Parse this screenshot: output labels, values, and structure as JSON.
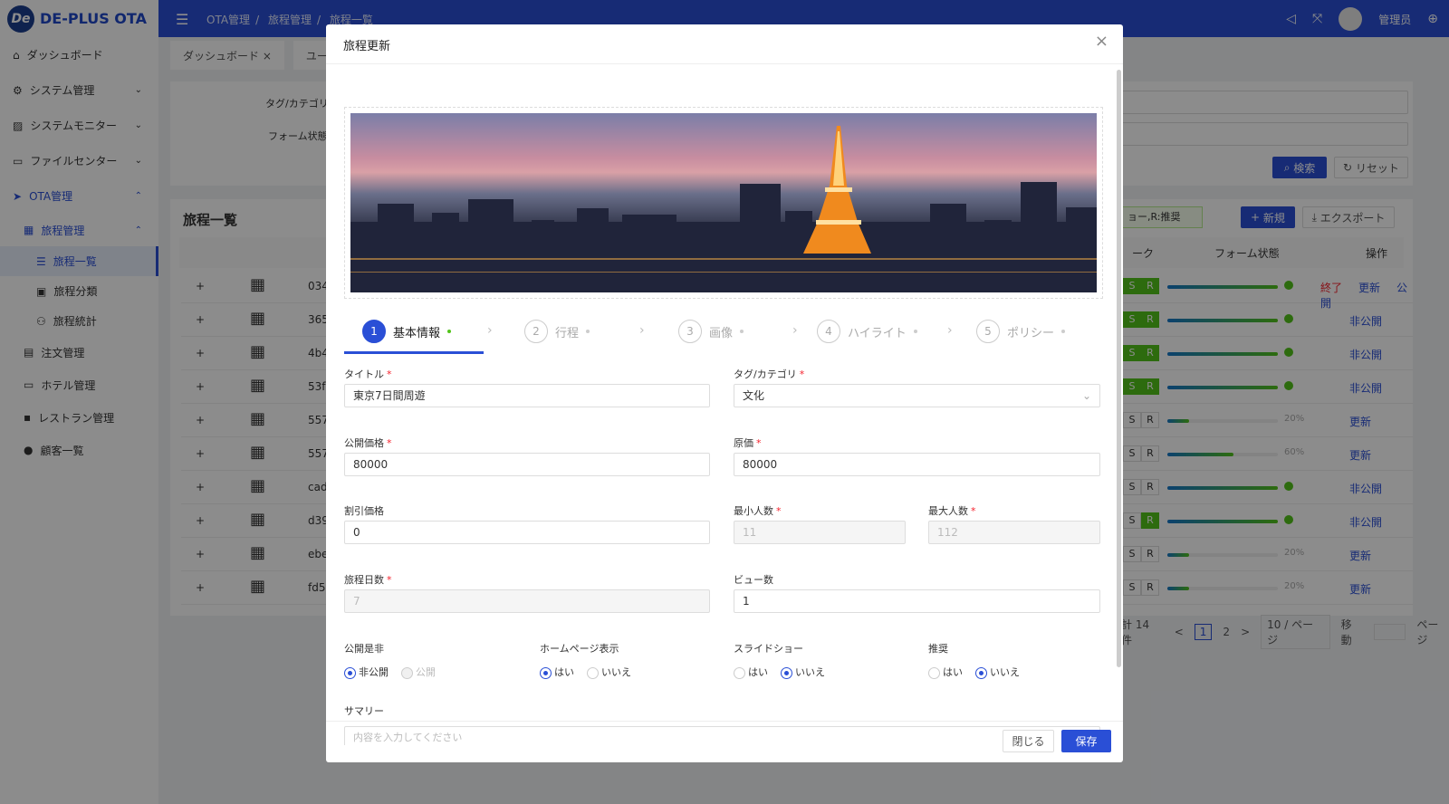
{
  "app": {
    "name": "DE-PLUS OTA",
    "logo_text": "De"
  },
  "header": {
    "breadcrumb": [
      "OTA管理",
      "旅程管理",
      "旅程一覧"
    ],
    "user": "管理员"
  },
  "sidebar": {
    "items": [
      {
        "label": "ダッシュボード",
        "icon": "home-icon"
      },
      {
        "label": "システム管理",
        "icon": "gear-icon"
      },
      {
        "label": "システムモニター",
        "icon": "chart-icon"
      },
      {
        "label": "ファイルセンター",
        "icon": "folder-icon"
      },
      {
        "label": "OTA管理",
        "icon": "send-icon"
      },
      {
        "label": "旅程管理",
        "icon": "grid-icon"
      },
      {
        "label": "旅程一覧",
        "icon": "list-icon"
      },
      {
        "label": "旅程分類",
        "icon": "category-icon"
      },
      {
        "label": "旅程統計",
        "icon": "stats-icon"
      },
      {
        "label": "注文管理",
        "icon": "order-icon"
      },
      {
        "label": "ホテル管理",
        "icon": "hotel-icon"
      },
      {
        "label": "レストラン管理",
        "icon": "restaurant-icon"
      },
      {
        "label": "顧客一覧",
        "icon": "customer-icon"
      }
    ]
  },
  "tabs": [
    "ダッシュボード",
    "ユーザ"
  ],
  "search": {
    "tag_label": "タグ/カテゴリ",
    "form_label": "フォーム状態",
    "search_btn": "検索",
    "reset_btn": "リセット"
  },
  "list": {
    "title": "旅程一覧",
    "legend": "ョー,R:推奨",
    "new_btn": "新規",
    "export_btn": "エクスポート",
    "columns": {
      "mark": "ーク",
      "form_state": "フォーム状態",
      "ops": "操作"
    },
    "rows": [
      {
        "id": "034",
        "s": false,
        "r": true,
        "sr_green": true,
        "progress": 100,
        "actions": [
          "終了",
          "更新",
          "公開"
        ]
      },
      {
        "id": "365",
        "sr_green": true,
        "progress": 100,
        "actions": [
          "非公開"
        ]
      },
      {
        "id": "4b4",
        "sr_green": true,
        "progress": 100,
        "actions": [
          "非公開"
        ]
      },
      {
        "id": "53f",
        "sr_green": true,
        "progress": 100,
        "actions": [
          "非公開"
        ]
      },
      {
        "id": "557",
        "sr_green": false,
        "progress": 20,
        "actions": [
          "更新"
        ]
      },
      {
        "id": "557",
        "sr_green": false,
        "progress": 60,
        "actions": [
          "更新"
        ]
      },
      {
        "id": "cad",
        "sr_green": false,
        "progress": 100,
        "actions": [
          "非公開"
        ]
      },
      {
        "id": "d39",
        "sr_green": false,
        "r_green": true,
        "progress": 100,
        "actions": [
          "非公開"
        ]
      },
      {
        "id": "ebe",
        "sr_green": false,
        "progress": 20,
        "actions": [
          "更新"
        ]
      },
      {
        "id": "fd5",
        "sr_green": false,
        "progress": 20,
        "actions": [
          "更新"
        ]
      }
    ],
    "pagination": {
      "total": "計 14 件",
      "pages": [
        "1",
        "2"
      ],
      "page_size": "10 / ページ",
      "jump": "移動",
      "page_suffix": "ページ"
    }
  },
  "modal": {
    "title": "旅程更新",
    "steps": [
      {
        "n": "1",
        "label": "基本情報"
      },
      {
        "n": "2",
        "label": "行程"
      },
      {
        "n": "3",
        "label": "画像"
      },
      {
        "n": "4",
        "label": "ハイライト"
      },
      {
        "n": "5",
        "label": "ポリシー"
      }
    ],
    "fields": {
      "title": {
        "label": "タイトル",
        "value": "東京7日間周遊"
      },
      "tag": {
        "label": "タグ/カテゴリ",
        "value": "文化"
      },
      "public_price": {
        "label": "公開価格",
        "value": "80000"
      },
      "cost": {
        "label": "原価",
        "value": "80000"
      },
      "discount": {
        "label": "割引価格",
        "value": "0"
      },
      "min_people": {
        "label": "最小人数",
        "value": "11"
      },
      "max_people": {
        "label": "最大人数",
        "value": "112"
      },
      "days": {
        "label": "旅程日数",
        "value": "7"
      },
      "views": {
        "label": "ビュー数",
        "value": "1"
      },
      "publish": {
        "label": "公開是非",
        "options": [
          "非公開",
          "公開"
        ],
        "selected": "非公開"
      },
      "homepage": {
        "label": "ホームページ表示",
        "options": [
          "はい",
          "いいえ"
        ],
        "selected": "はい"
      },
      "slideshow": {
        "label": "スライドショー",
        "options": [
          "はい",
          "いいえ"
        ],
        "selected": "いいえ"
      },
      "recommend": {
        "label": "推奨",
        "options": [
          "はい",
          "いいえ"
        ],
        "selected": "いいえ"
      },
      "summary": {
        "label": "サマリー",
        "placeholder": "内容を入力してください"
      }
    },
    "close_btn": "閉じる",
    "save_btn": "保存"
  },
  "colors": {
    "primary": "#2a4fd6",
    "success": "#52c41a",
    "danger": "#f5222d"
  }
}
